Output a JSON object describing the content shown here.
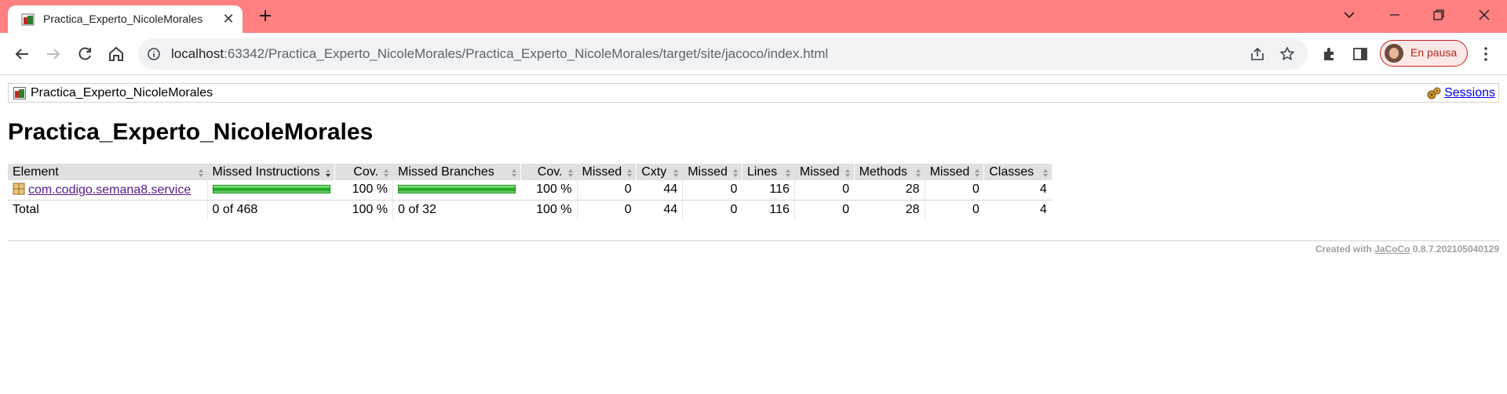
{
  "browser": {
    "tab_title": "Practica_Experto_NicoleMorales",
    "url_host": "localhost",
    "url_path": ":63342/Practica_Experto_NicoleMorales/Practica_Experto_NicoleMorales/target/site/jacoco/index.html",
    "profile_label": "En pausa",
    "accent_color": "#fe8080"
  },
  "report": {
    "breadcrumb": "Practica_Experto_NicoleMorales",
    "sessions_label": "Sessions",
    "title": "Practica_Experto_NicoleMorales",
    "columns": {
      "element": "Element",
      "missed_instructions": "Missed Instructions",
      "cov1": "Cov.",
      "missed_branches": "Missed Branches",
      "cov2": "Cov.",
      "missed_cxty": "Missed",
      "cxty": "Cxty",
      "missed_lines": "Missed",
      "lines": "Lines",
      "missed_methods": "Missed",
      "methods": "Methods",
      "missed_classes": "Missed",
      "classes": "Classes"
    },
    "rows": [
      {
        "element": "com.codigo.semana8.service",
        "instr_coverage_fraction": 1.0,
        "cov1": "100 %",
        "branch_coverage_fraction": 1.0,
        "cov2": "100 %",
        "missed_cxty": "0",
        "cxty": "44",
        "missed_lines": "0",
        "lines": "116",
        "missed_methods": "0",
        "methods": "28",
        "missed_classes": "0",
        "classes": "4"
      }
    ],
    "total": {
      "label": "Total",
      "missed_instructions": "0 of 468",
      "cov1": "100 %",
      "missed_branches": "0 of 32",
      "cov2": "100 %",
      "missed_cxty": "0",
      "cxty": "44",
      "missed_lines": "0",
      "lines": "116",
      "missed_methods": "0",
      "methods": "28",
      "missed_classes": "0",
      "classes": "4"
    },
    "footer": {
      "prefix": "Created with",
      "link": "JaCoCo",
      "version": "0.8.7.202105040129"
    }
  }
}
